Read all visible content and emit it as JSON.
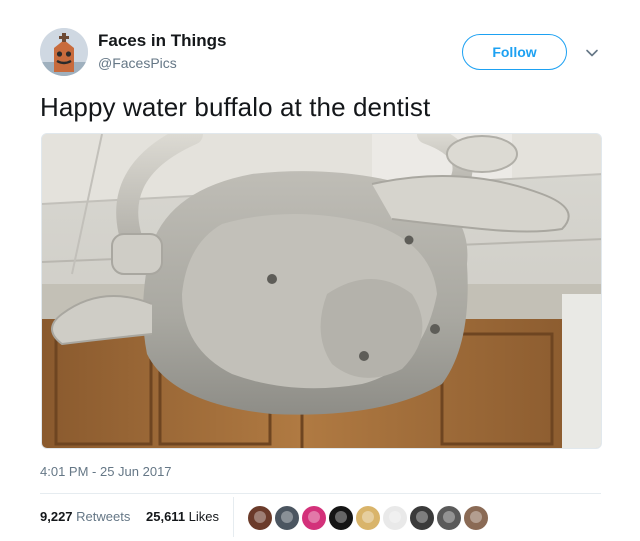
{
  "author": {
    "name": "Faces in Things",
    "handle": "@FacesPics",
    "follow_label": "Follow"
  },
  "tweet": {
    "text": "Happy water buffalo at the dentist",
    "timestamp": "4:01 PM - 25 Jun 2017"
  },
  "stats": {
    "retweets_count": "9,227",
    "retweets_label": "Retweets",
    "likes_count": "25,611",
    "likes_label": "Likes"
  },
  "colors": {
    "accent": "#1da1f2",
    "secondary_text": "#657786"
  },
  "likers": [
    {
      "color": "#6b3b2a"
    },
    {
      "color": "#4b5560"
    },
    {
      "color": "#d3317a"
    },
    {
      "color": "#151515"
    },
    {
      "color": "#d9b46a"
    },
    {
      "color": "#e9e9e9"
    },
    {
      "color": "#3a3a3a"
    },
    {
      "color": "#5a5a5a"
    },
    {
      "color": "#8a6a55"
    }
  ]
}
